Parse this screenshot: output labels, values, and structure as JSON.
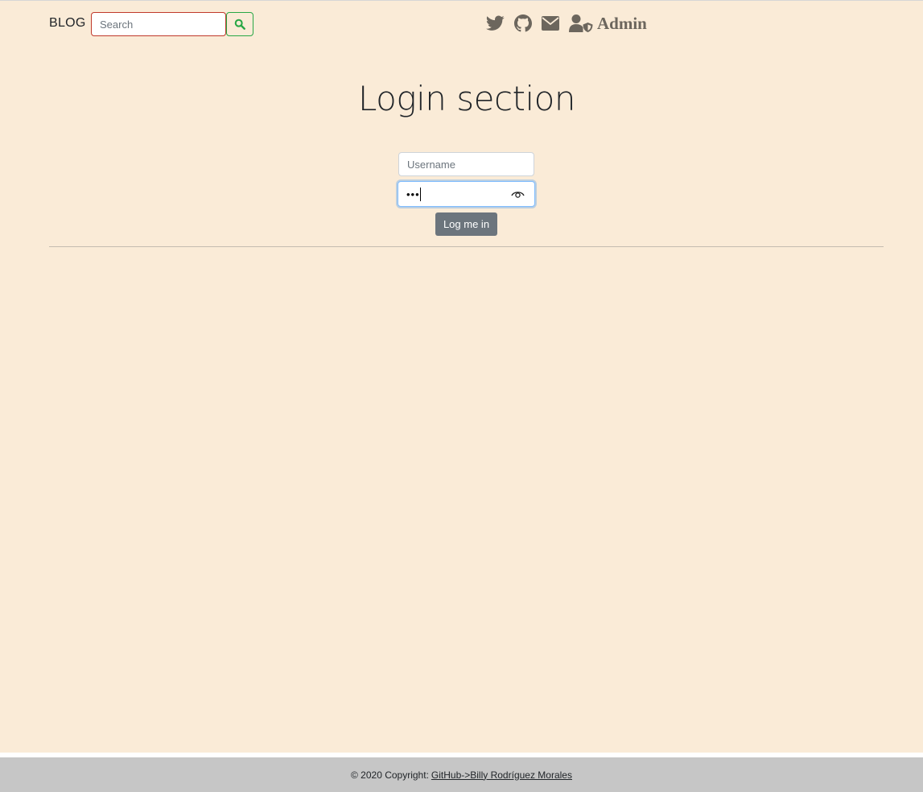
{
  "navbar": {
    "brand": "BLOG",
    "search": {
      "placeholder": "Search",
      "button_icon": "search-icon"
    },
    "icons": [
      "twitter-icon",
      "github-icon",
      "envelope-icon",
      "user-shield-icon"
    ],
    "admin_label": "Admin"
  },
  "login": {
    "title": "Login section",
    "username_placeholder": "Username",
    "password_value": "•••",
    "password_toggle_icon": "eye-icon",
    "submit_label": "Log me in"
  },
  "footer": {
    "copyright": "© 2020 Copyright:",
    "link_label": "GitHub->Billy Rodríguez Morales"
  },
  "colors": {
    "background": "#faebd7",
    "footer": "#c6c6c6",
    "search_border": "#c0392b",
    "search_button_border": "#28a745",
    "button": "#6c757d",
    "icons": "#6c665d"
  }
}
